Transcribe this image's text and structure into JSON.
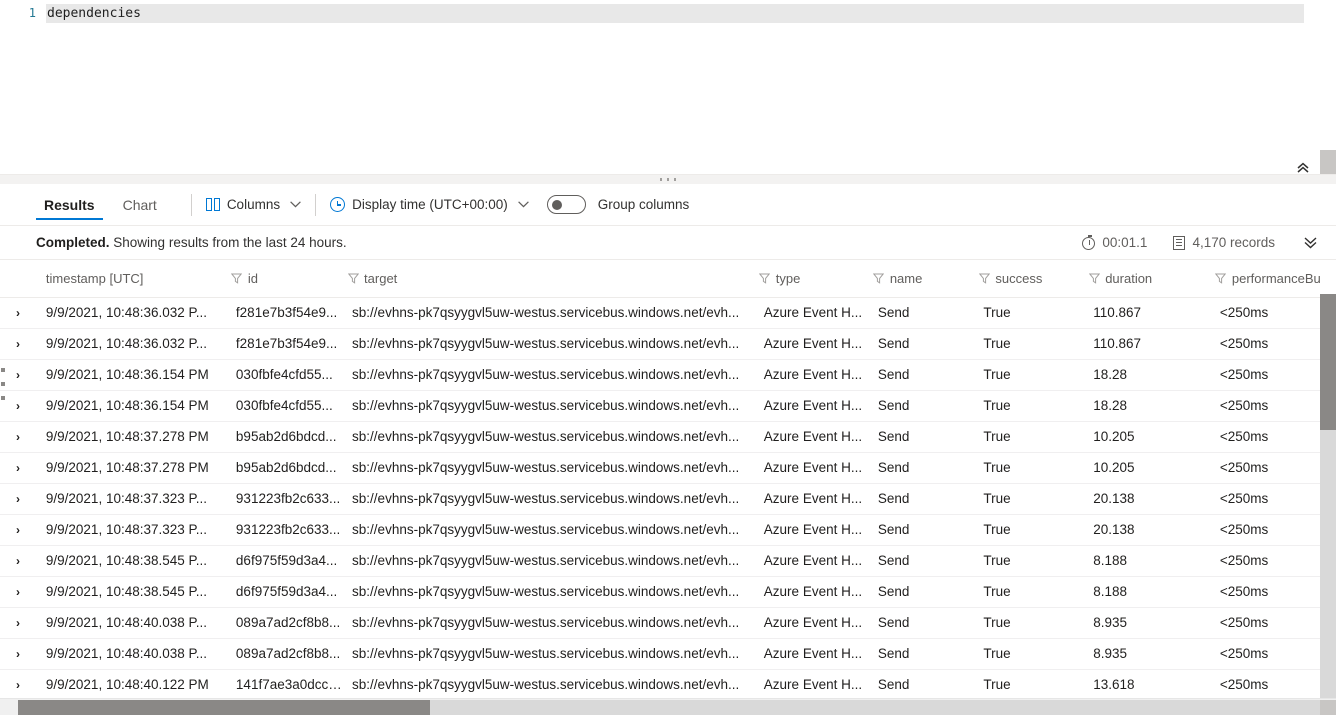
{
  "editor": {
    "line_number": "1",
    "query": "dependencies"
  },
  "toolbar": {
    "tabs": [
      {
        "label": "Results",
        "active": true
      },
      {
        "label": "Chart",
        "active": false
      }
    ],
    "columns_label": "Columns",
    "display_time_label": "Display time (UTC+00:00)",
    "group_columns_label": "Group columns",
    "group_columns_on": false,
    "accent_color": "#0078d4"
  },
  "status": {
    "state": "Completed.",
    "message": "Showing results from the last 24 hours.",
    "elapsed": "00:01.1",
    "records": "4,170 records"
  },
  "table": {
    "columns": [
      "timestamp [UTC]",
      "id",
      "target",
      "type",
      "name",
      "success",
      "duration",
      "performanceBucket"
    ],
    "rows": [
      {
        "timestamp": "9/9/2021, 10:48:36.032 P...",
        "id": "f281e7b3f54e9...",
        "target": "sb://evhns-pk7qsyygvl5uw-westus.servicebus.windows.net/evh...",
        "type": "Azure Event H...",
        "name": "Send",
        "success": "True",
        "duration": "110.867",
        "performanceBucket": "<250ms"
      },
      {
        "timestamp": "9/9/2021, 10:48:36.032 P...",
        "id": "f281e7b3f54e9...",
        "target": "sb://evhns-pk7qsyygvl5uw-westus.servicebus.windows.net/evh...",
        "type": "Azure Event H...",
        "name": "Send",
        "success": "True",
        "duration": "110.867",
        "performanceBucket": "<250ms"
      },
      {
        "timestamp": "9/9/2021, 10:48:36.154 PM",
        "id": "030fbfe4cfd55...",
        "target": "sb://evhns-pk7qsyygvl5uw-westus.servicebus.windows.net/evh...",
        "type": "Azure Event H...",
        "name": "Send",
        "success": "True",
        "duration": "18.28",
        "performanceBucket": "<250ms"
      },
      {
        "timestamp": "9/9/2021, 10:48:36.154 PM",
        "id": "030fbfe4cfd55...",
        "target": "sb://evhns-pk7qsyygvl5uw-westus.servicebus.windows.net/evh...",
        "type": "Azure Event H...",
        "name": "Send",
        "success": "True",
        "duration": "18.28",
        "performanceBucket": "<250ms"
      },
      {
        "timestamp": "9/9/2021, 10:48:37.278 PM",
        "id": "b95ab2d6bdcd...",
        "target": "sb://evhns-pk7qsyygvl5uw-westus.servicebus.windows.net/evh...",
        "type": "Azure Event H...",
        "name": "Send",
        "success": "True",
        "duration": "10.205",
        "performanceBucket": "<250ms"
      },
      {
        "timestamp": "9/9/2021, 10:48:37.278 PM",
        "id": "b95ab2d6bdcd...",
        "target": "sb://evhns-pk7qsyygvl5uw-westus.servicebus.windows.net/evh...",
        "type": "Azure Event H...",
        "name": "Send",
        "success": "True",
        "duration": "10.205",
        "performanceBucket": "<250ms"
      },
      {
        "timestamp": "9/9/2021, 10:48:37.323 P...",
        "id": "931223fb2c633...",
        "target": "sb://evhns-pk7qsyygvl5uw-westus.servicebus.windows.net/evh...",
        "type": "Azure Event H...",
        "name": "Send",
        "success": "True",
        "duration": "20.138",
        "performanceBucket": "<250ms"
      },
      {
        "timestamp": "9/9/2021, 10:48:37.323 P...",
        "id": "931223fb2c633...",
        "target": "sb://evhns-pk7qsyygvl5uw-westus.servicebus.windows.net/evh...",
        "type": "Azure Event H...",
        "name": "Send",
        "success": "True",
        "duration": "20.138",
        "performanceBucket": "<250ms"
      },
      {
        "timestamp": "9/9/2021, 10:48:38.545 P...",
        "id": "d6f975f59d3a4...",
        "target": "sb://evhns-pk7qsyygvl5uw-westus.servicebus.windows.net/evh...",
        "type": "Azure Event H...",
        "name": "Send",
        "success": "True",
        "duration": "8.188",
        "performanceBucket": "<250ms"
      },
      {
        "timestamp": "9/9/2021, 10:48:38.545 P...",
        "id": "d6f975f59d3a4...",
        "target": "sb://evhns-pk7qsyygvl5uw-westus.servicebus.windows.net/evh...",
        "type": "Azure Event H...",
        "name": "Send",
        "success": "True",
        "duration": "8.188",
        "performanceBucket": "<250ms"
      },
      {
        "timestamp": "9/9/2021, 10:48:40.038 P...",
        "id": "089a7ad2cf8b8...",
        "target": "sb://evhns-pk7qsyygvl5uw-westus.servicebus.windows.net/evh...",
        "type": "Azure Event H...",
        "name": "Send",
        "success": "True",
        "duration": "8.935",
        "performanceBucket": "<250ms"
      },
      {
        "timestamp": "9/9/2021, 10:48:40.038 P...",
        "id": "089a7ad2cf8b8...",
        "target": "sb://evhns-pk7qsyygvl5uw-westus.servicebus.windows.net/evh...",
        "type": "Azure Event H...",
        "name": "Send",
        "success": "True",
        "duration": "8.935",
        "performanceBucket": "<250ms"
      },
      {
        "timestamp": "9/9/2021, 10:48:40.122 PM",
        "id": "141f7ae3a0dcc1...",
        "target": "sb://evhns-pk7qsyygvl5uw-westus.servicebus.windows.net/evh...",
        "type": "Azure Event H...",
        "name": "Send",
        "success": "True",
        "duration": "13.618",
        "performanceBucket": "<250ms"
      }
    ],
    "expand_glyph": "›",
    "filter_glyph": "▽"
  }
}
